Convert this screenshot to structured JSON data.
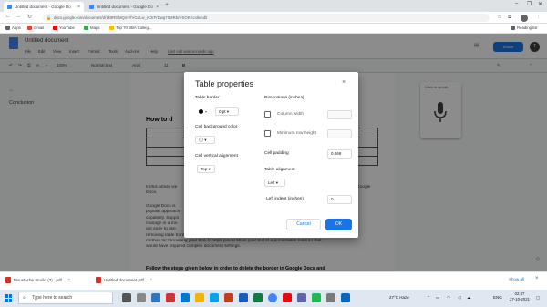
{
  "browser": {
    "tabs": [
      {
        "title": "Untitled document - Google Do",
        "active": true
      },
      {
        "title": "Untitled document - Google Do",
        "active": false
      }
    ],
    "new_tab": "+",
    "url": "docs.google.com/document/d/1k9R6fMQmYfVGdLw_KOrFrDwg7ItMRbnvSOKEcxIk/edit",
    "bookmarks": [
      "Apps",
      "Gmail",
      "YouTube",
      "Maps",
      "Top 70 BBA Colleg..."
    ],
    "reading_list": "Reading list"
  },
  "docs": {
    "title": "Untitled document",
    "menu": [
      "File",
      "Edit",
      "View",
      "Insert",
      "Format",
      "Tools",
      "Add-ons",
      "Help"
    ],
    "last_edit": "Last edit was seconds ago",
    "share_label": "Share",
    "avatar_letter": "T",
    "toolbar": {
      "zoom": "100%",
      "style": "Normal text",
      "font": "Arial",
      "size": "11"
    },
    "outline": {
      "back": "←",
      "heading": "Conclusion"
    },
    "page": {
      "heading": "How to d",
      "lines": [
        "In this article we",
        "Docs.",
        "Google Docs is",
        "popular approach",
        "capability. Suppo",
        "manage in a mo",
        "are easy to use,",
        "removing table borders can be tricky. Deleting borders in your specific document is a brilliant",
        "method for formatting your text. It helps you to show your text in a presentable manner that",
        "would have required complex document settings."
      ],
      "line_tail": "Google"
    },
    "voice_typing_label": "Click to speak",
    "below_heading": "Follow the steps given below in order to delete the border in Google Docs and"
  },
  "dialog": {
    "title": "Table properties",
    "close": "×",
    "table_border_label": "Table border",
    "border_width": "0 pt",
    "cell_bg_label": "Cell background color",
    "cell_valign_label": "Cell vertical alignment",
    "valign_value": "Top",
    "dimensions_label": "Dimensions (inches)",
    "column_width_label": "Column width",
    "min_row_height_label": "Minimum row height",
    "cell_padding_label": "Cell padding",
    "cell_padding_value": "0.069",
    "table_alignment_label": "Table alignment",
    "alignment_value": "Left",
    "left_indent_label": "Left indent (inches)",
    "left_indent_value": "0",
    "cancel_label": "Cancel",
    "ok_label": "OK"
  },
  "downloads": {
    "items": [
      "Moustache Studio (3)...pdf",
      "Untitled document.pdf"
    ],
    "show_all": "Show all"
  },
  "taskbar": {
    "search_placeholder": "Type here to search",
    "weather": "27°C  Haze",
    "language": "ENG",
    "time": "02:47",
    "date": "27-10-2021"
  },
  "colors": {
    "accent": "#1a73e8",
    "overlay": "rgba(0,0,0,0.45)"
  }
}
